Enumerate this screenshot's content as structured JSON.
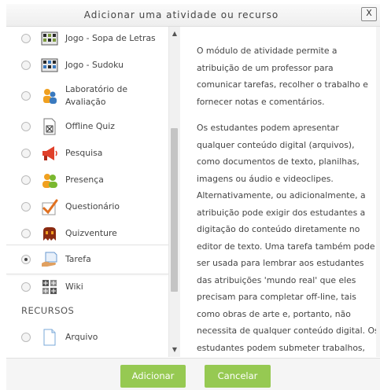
{
  "dialog": {
    "title": "Adicionar uma atividade ou recurso",
    "close_label": "X"
  },
  "colors": {
    "button": "#96c952",
    "selected_bg": "#ffffff",
    "text": "#444444"
  },
  "list": {
    "items": [
      {
        "label": "Jogo - Sopa de Letras",
        "icon": "puzzle-grid-icon",
        "selected": false
      },
      {
        "label": "Jogo - Sudoku",
        "icon": "sudoku-icon",
        "selected": false
      },
      {
        "label": "Laboratório de Avaliação",
        "icon": "workshop-people-icon",
        "selected": false
      },
      {
        "label": "Offline Quiz",
        "icon": "offline-quiz-icon",
        "selected": false
      },
      {
        "label": "Pesquisa",
        "icon": "megaphone-icon",
        "selected": false
      },
      {
        "label": "Presença",
        "icon": "attendance-people-icon",
        "selected": false
      },
      {
        "label": "Questionário",
        "icon": "checkmark-icon",
        "selected": false
      },
      {
        "label": "Quizventure",
        "icon": "quizventure-icon",
        "selected": false
      },
      {
        "label": "Tarefa",
        "icon": "assignment-hand-icon",
        "selected": true
      },
      {
        "label": "Wiki",
        "icon": "wiki-icon",
        "selected": false
      }
    ],
    "resources_heading": "RECURSOS",
    "resources": [
      {
        "label": "Arquivo",
        "icon": "file-icon",
        "selected": false
      }
    ]
  },
  "description": {
    "p1": "O módulo de atividade permite a atribuição de um professor para comunicar tarefas, recolher o trabalho e fornecer notas e comentários.",
    "p2": "Os estudantes podem apresentar qualquer conteúdo digital (arquivos), como documentos de texto, planilhas, imagens ou áudio e videoclipes. Alternativamente, ou adicionalmente, a atribuição pode exigir dos estudantes a digitação do conteúdo diretamente no editor de texto. Uma tarefa também pode ser usada para lembrar aos estudantes das atribuições 'mundo real' que eles precisam para completar off-line, tais como obras de arte e, portanto, não necessita de qualquer conteúdo digital. Os estudantes podem submeter trabalhos, individualmente ou como membro de um"
  },
  "footer": {
    "add_label": "Adicionar",
    "cancel_label": "Cancelar"
  }
}
